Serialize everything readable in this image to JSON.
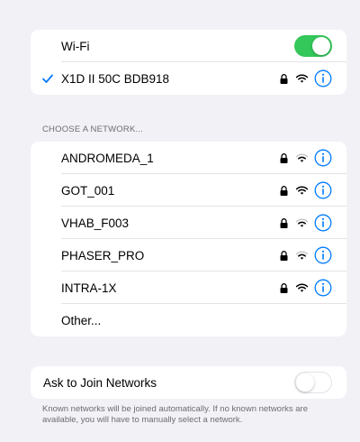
{
  "colors": {
    "accent": "#007aff",
    "toggle_on": "#34c759",
    "background": "#f2f1f6"
  },
  "wifi": {
    "label": "Wi-Fi",
    "enabled": true
  },
  "connected": {
    "name": "X1D II 50C BDB918",
    "secured": true,
    "icons": [
      "checkmark-icon",
      "lock-icon",
      "wifi-signal-icon",
      "info-icon"
    ]
  },
  "networks": {
    "header": "CHOOSE A NETWORK...",
    "items": [
      {
        "name": "ANDROMEDA_1",
        "secured": true
      },
      {
        "name": "GOT_001",
        "secured": true
      },
      {
        "name": "VHAB_F003",
        "secured": true
      },
      {
        "name": "PHASER_PRO",
        "secured": true
      },
      {
        "name": "INTRA-1X",
        "secured": true
      }
    ],
    "other_label": "Other..."
  },
  "ask_to_join": {
    "label": "Ask to Join Networks",
    "enabled": false,
    "footer": "Known networks will be joined automatically. If no known networks are available, you will have to manually select a network."
  }
}
